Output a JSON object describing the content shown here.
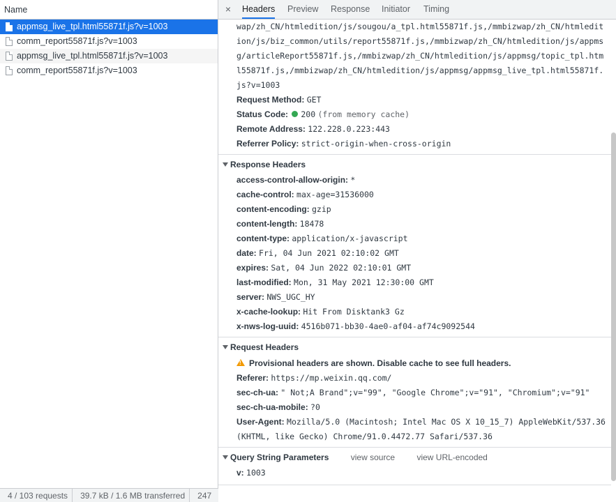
{
  "left": {
    "column_header": "Name",
    "requests": [
      {
        "name": "appmsg_live_tpl.html55871f.js?v=1003",
        "selected": true
      },
      {
        "name": "comm_report55871f.js?v=1003",
        "selected": false
      },
      {
        "name": "appmsg_live_tpl.html55871f.js?v=1003",
        "selected": false
      },
      {
        "name": "comm_report55871f.js?v=1003",
        "selected": false
      }
    ],
    "status": {
      "requests": "4 / 103 requests",
      "transferred": "39.7 kB / 1.6 MB transferred",
      "resources": "247"
    }
  },
  "tabs": {
    "close": "×",
    "items": [
      "Headers",
      "Preview",
      "Response",
      "Initiator",
      "Timing"
    ],
    "active": "Headers"
  },
  "general": {
    "url_tail": "wap/zh_CN/htmledition/js/sougou/a_tpl.html55871f.js,/mmbizwap/zh_CN/htmledition/js/biz_common/utils/report55871f.js,/mmbizwap/zh_CN/htmledition/js/appmsg/articleReport55871f.js,/mmbizwap/zh_CN/htmledition/js/appmsg/topic_tpl.html55871f.js,/mmbizwap/zh_CN/htmledition/js/appmsg/appmsg_live_tpl.html55871f.js?v=1003",
    "request_method": {
      "key": "Request Method:",
      "value": "GET"
    },
    "status_code": {
      "key": "Status Code:",
      "value": "200",
      "note": "(from memory cache)",
      "dot_color": "#34a853"
    },
    "remote_address": {
      "key": "Remote Address:",
      "value": "122.228.0.223:443"
    },
    "referrer_policy": {
      "key": "Referrer Policy:",
      "value": "strict-origin-when-cross-origin"
    }
  },
  "response_headers": {
    "title": "Response Headers",
    "items": [
      {
        "key": "access-control-allow-origin:",
        "value": "*"
      },
      {
        "key": "cache-control:",
        "value": "max-age=31536000"
      },
      {
        "key": "content-encoding:",
        "value": "gzip"
      },
      {
        "key": "content-length:",
        "value": "18478"
      },
      {
        "key": "content-type:",
        "value": "application/x-javascript"
      },
      {
        "key": "date:",
        "value": "Fri, 04 Jun 2021 02:10:02 GMT"
      },
      {
        "key": "expires:",
        "value": "Sat, 04 Jun 2022 02:10:01 GMT"
      },
      {
        "key": "last-modified:",
        "value": "Mon, 31 May 2021 12:30:00 GMT"
      },
      {
        "key": "server:",
        "value": "NWS_UGC_HY"
      },
      {
        "key": "x-cache-lookup:",
        "value": "Hit From Disktank3 Gz"
      },
      {
        "key": "x-nws-log-uuid:",
        "value": "4516b071-bb30-4ae0-af04-af74c9092544"
      }
    ]
  },
  "request_headers": {
    "title": "Request Headers",
    "warning": "Provisional headers are shown. Disable cache to see full headers.",
    "items": [
      {
        "key": "Referer:",
        "value": "https://mp.weixin.qq.com/"
      },
      {
        "key": "sec-ch-ua:",
        "value": "\" Not;A Brand\";v=\"99\", \"Google Chrome\";v=\"91\", \"Chromium\";v=\"91\""
      },
      {
        "key": "sec-ch-ua-mobile:",
        "value": "?0"
      },
      {
        "key": "User-Agent:",
        "value": "Mozilla/5.0 (Macintosh; Intel Mac OS X 10_15_7) AppleWebKit/537.36 (KHTML, like Gecko) Chrome/91.0.4472.77 Safari/537.36"
      }
    ]
  },
  "query_params": {
    "title": "Query String Parameters",
    "view_source": "view source",
    "view_url_encoded": "view URL-encoded",
    "items": [
      {
        "key": "v:",
        "value": "1003"
      }
    ]
  },
  "colors": {
    "selected_row": "#1a73e8",
    "active_tab_underline": "#1a73e8",
    "warning": "#f29900",
    "status_ok": "#34a853"
  }
}
